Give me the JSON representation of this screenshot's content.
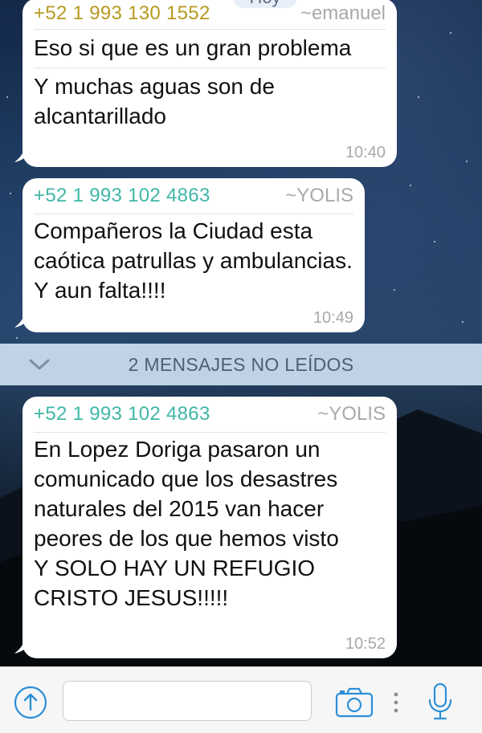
{
  "chat": {
    "date_label": "Hoy",
    "messages": [
      {
        "phone": "+52 1 993 130 1552",
        "alias": "~emanuel",
        "lines": [
          "Eso si que es un gran problema",
          "Y muchas aguas son de alcantarillado"
        ],
        "time": "10:40"
      },
      {
        "phone": "+52 1 993 102 4863",
        "alias": "~YOLIS",
        "lines": [
          "Compañeros la Ciudad esta caótica patrullas y ambulancias. Y aun falta!!!!"
        ],
        "time": "10:49"
      },
      {
        "phone": "+52 1 993 102 4863",
        "alias": "~YOLIS",
        "lines": [
          "En Lopez Doriga pasaron un comunicado que los desastres naturales del 2015 van hacer peores de los que hemos visto",
          "Y SOLO HAY UN REFUGIO CRISTO JESUS!!!!!"
        ],
        "time": "10:52"
      }
    ],
    "unread_label": "2 MENSAJES NO LEÍDOS"
  },
  "input_bar": {
    "message_value": "",
    "message_placeholder": "",
    "icons": [
      "upload-icon",
      "camera-icon",
      "more-dots-icon",
      "microphone-icon"
    ]
  },
  "colors": {
    "accent": "#2b8fd8",
    "phone_yellow": "#b59a1f",
    "phone_teal": "#3fb7a8",
    "unread_bar": "#cddef0"
  }
}
